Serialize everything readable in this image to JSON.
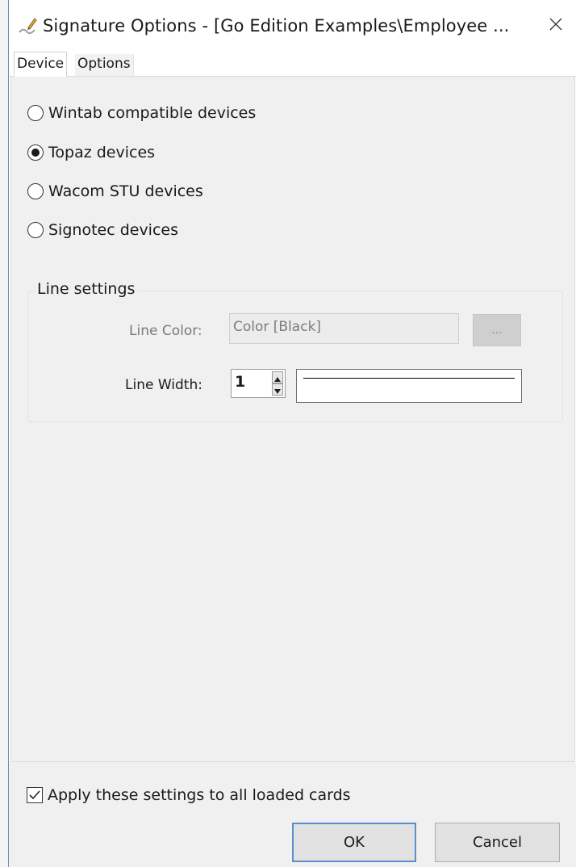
{
  "window": {
    "title": "Signature Options - [Go Edition Examples\\Employee ...",
    "icon": "pen-signature-icon",
    "close_glyph": "✕"
  },
  "tabs": [
    {
      "label": "Device",
      "active": true
    },
    {
      "label": "Options",
      "active": false
    }
  ],
  "devices": {
    "options": [
      {
        "label": "Wintab compatible devices",
        "selected": false
      },
      {
        "label": "Topaz devices",
        "selected": true
      },
      {
        "label": "Wacom STU devices",
        "selected": false
      },
      {
        "label": "Signotec devices",
        "selected": false
      }
    ]
  },
  "line_settings": {
    "title": "Line settings",
    "color_label": "Line Color:",
    "color_value": "Color [Black]",
    "color_button_label": "...",
    "width_label": "Line Width:",
    "width_value": "1"
  },
  "footer": {
    "apply_all_label": "Apply these settings to all loaded cards",
    "apply_all_checked": true,
    "ok_label": "OK",
    "cancel_label": "Cancel"
  }
}
